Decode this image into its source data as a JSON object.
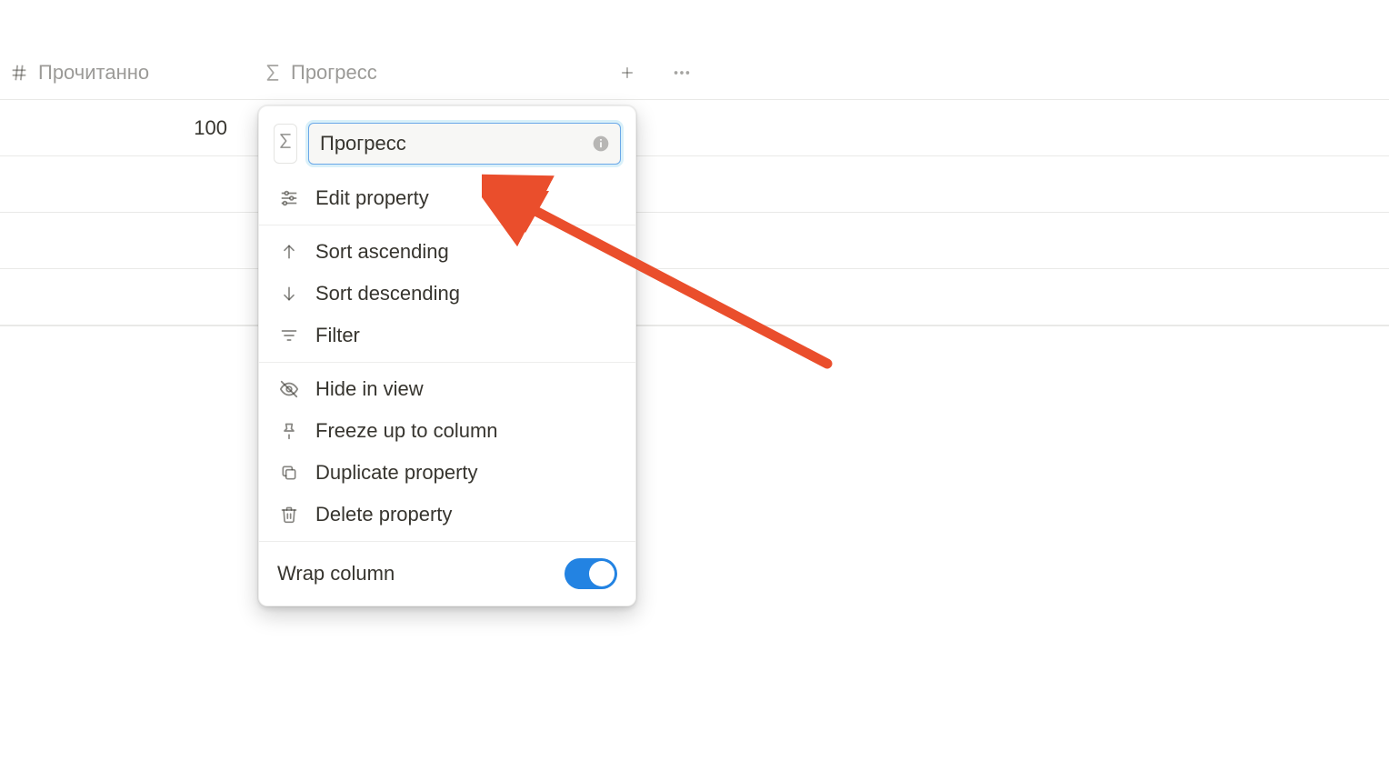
{
  "columns": {
    "read": {
      "label": "Прочитанно",
      "icon": "hash"
    },
    "progress": {
      "label": "Прогресс",
      "icon": "sigma"
    }
  },
  "row_value": "100",
  "dropdown": {
    "name_value": "Прогресс",
    "items": {
      "edit": {
        "label": "Edit property"
      },
      "sortAsc": {
        "label": "Sort ascending"
      },
      "sortDesc": {
        "label": "Sort descending"
      },
      "filter": {
        "label": "Filter"
      },
      "hide": {
        "label": "Hide in view"
      },
      "freeze": {
        "label": "Freeze up to column"
      },
      "duplicate": {
        "label": "Duplicate property"
      },
      "delete": {
        "label": "Delete property"
      }
    },
    "wrap": {
      "label": "Wrap column",
      "on": true
    }
  },
  "colors": {
    "arrow": "#ea4e2c",
    "accent": "#2383e2"
  }
}
